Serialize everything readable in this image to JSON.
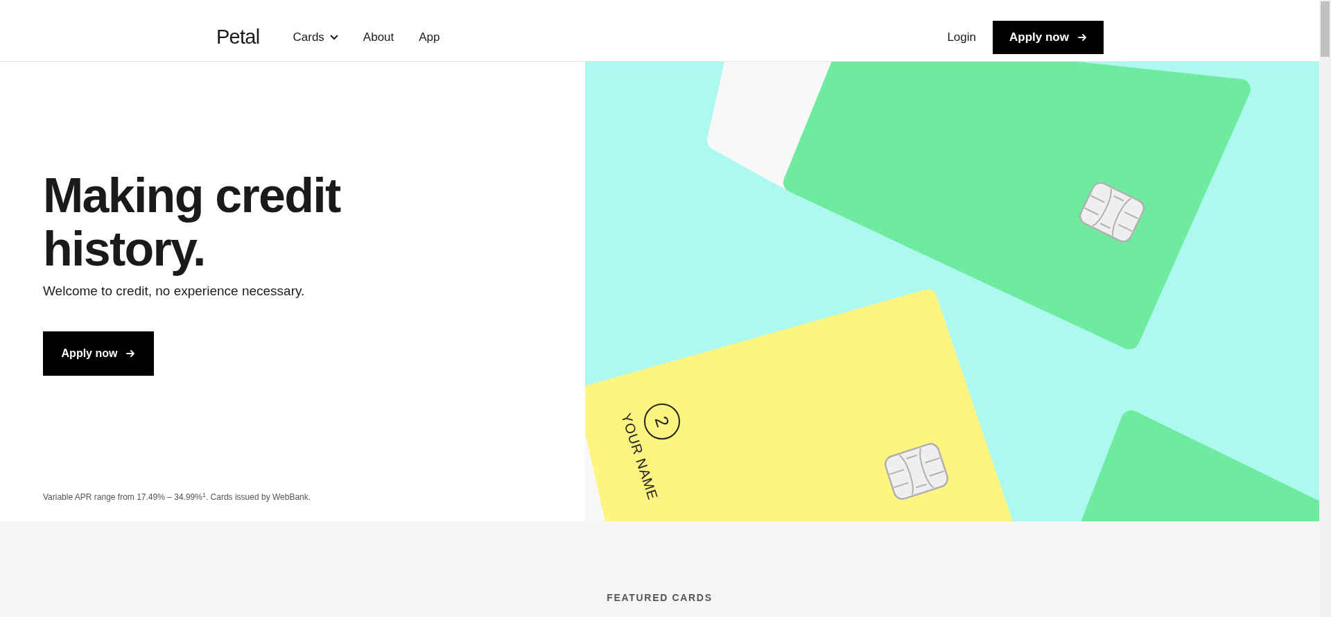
{
  "header": {
    "logo": "Petal",
    "nav": [
      {
        "label": "Cards",
        "kind": "dropdown"
      },
      {
        "label": "About",
        "kind": "link"
      },
      {
        "label": "App",
        "kind": "link"
      }
    ],
    "login": "Login",
    "apply": "Apply now"
  },
  "hero": {
    "title": "Making credit history.",
    "subtitle": "Welcome to credit, no experience necessary.",
    "button": "Apply now",
    "footnote": "Variable APR range from 17.49% – 34.99%$^{1}$. Cards issued by WebBank.",
    "card": {
      "number": "2",
      "name": "YOUR NAME"
    }
  },
  "featured": {
    "heading": "FEATURED CARDS"
  }
}
